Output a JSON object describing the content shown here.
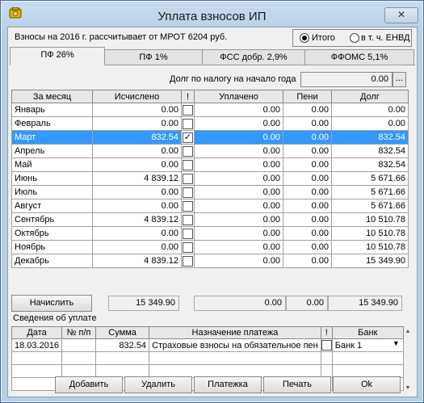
{
  "window": {
    "title": "Уплата взносов ИП",
    "close_label": "✕"
  },
  "info_line": "Взносы на 2016 г. рассчитывает от МРОТ 6204 руб.",
  "mode": {
    "option1": "Итого",
    "option2": "в т. ч. ЕНВД",
    "selected": "Итого"
  },
  "tabs": [
    {
      "label": "ПФ 26%",
      "active": true
    },
    {
      "label": "ПФ 1%",
      "active": false
    },
    {
      "label": "ФСС добр. 2,9%",
      "active": false
    },
    {
      "label": "ФФОМС 5,1%",
      "active": false
    }
  ],
  "debt": {
    "label": "Долг по налогу на начало года",
    "value": "0.00",
    "dots": "..."
  },
  "grid": {
    "headers": [
      "За месяц",
      "Исчислено",
      "!",
      "Уплачено",
      "Пени",
      "Долг"
    ],
    "rows": [
      {
        "month": "Январь",
        "calc": "0.00",
        "check": "",
        "paid": "0.00",
        "peni": "0.00",
        "debt": "0.00"
      },
      {
        "month": "Февраль",
        "calc": "0.00",
        "check": "",
        "paid": "0.00",
        "peni": "0.00",
        "debt": "0.00"
      },
      {
        "month": "Март",
        "calc": "832.54",
        "check": "✓",
        "paid": "0.00",
        "peni": "0.00",
        "debt": "832.54"
      },
      {
        "month": "Апрель",
        "calc": "0.00",
        "check": "",
        "paid": "0.00",
        "peni": "0.00",
        "debt": "832.54"
      },
      {
        "month": "Май",
        "calc": "0.00",
        "check": "",
        "paid": "0.00",
        "peni": "0.00",
        "debt": "832.54"
      },
      {
        "month": "Июнь",
        "calc": "4 839.12",
        "check": "",
        "paid": "0.00",
        "peni": "0.00",
        "debt": "5 671.66"
      },
      {
        "month": "Июль",
        "calc": "0.00",
        "check": "",
        "paid": "0.00",
        "peni": "0.00",
        "debt": "5 671.66"
      },
      {
        "month": "Август",
        "calc": "0.00",
        "check": "",
        "paid": "0.00",
        "peni": "0.00",
        "debt": "5 671.66"
      },
      {
        "month": "Сентябрь",
        "calc": "4 839.12",
        "check": "",
        "paid": "0.00",
        "peni": "0.00",
        "debt": "10 510.78"
      },
      {
        "month": "Октябрь",
        "calc": "0.00",
        "check": "",
        "paid": "0.00",
        "peni": "0.00",
        "debt": "10 510.78"
      },
      {
        "month": "Ноябрь",
        "calc": "0.00",
        "check": "",
        "paid": "0.00",
        "peni": "0.00",
        "debt": "10 510.78"
      },
      {
        "month": "Декабрь",
        "calc": "4 839.12",
        "check": "",
        "paid": "0.00",
        "peni": "0.00",
        "debt": "15 349.90"
      }
    ]
  },
  "totals": {
    "calc_button": "Начислить",
    "calc": "15 349.90",
    "paid": "0.00",
    "peni": "0.00",
    "debt": "15 349.90"
  },
  "payments": {
    "label": "Сведения об уплате",
    "headers": [
      "Дата",
      "№ п/п",
      "Сумма",
      "Назначение платежа",
      "!",
      "Банк"
    ],
    "rows": [
      {
        "date": "18.03.2016",
        "num": "",
        "sum": "832.54",
        "purpose": "Страховые взносы на обязательное пен",
        "check": "",
        "bank": "Банк 1"
      }
    ]
  },
  "buttons": {
    "add": "Добавить",
    "delete": "Удалить",
    "payment_order": "Платежка",
    "print": "Печать",
    "ok": "Ok"
  },
  "colors": {
    "selection": "#3399ff",
    "window_frame": "#b9cfe4"
  }
}
